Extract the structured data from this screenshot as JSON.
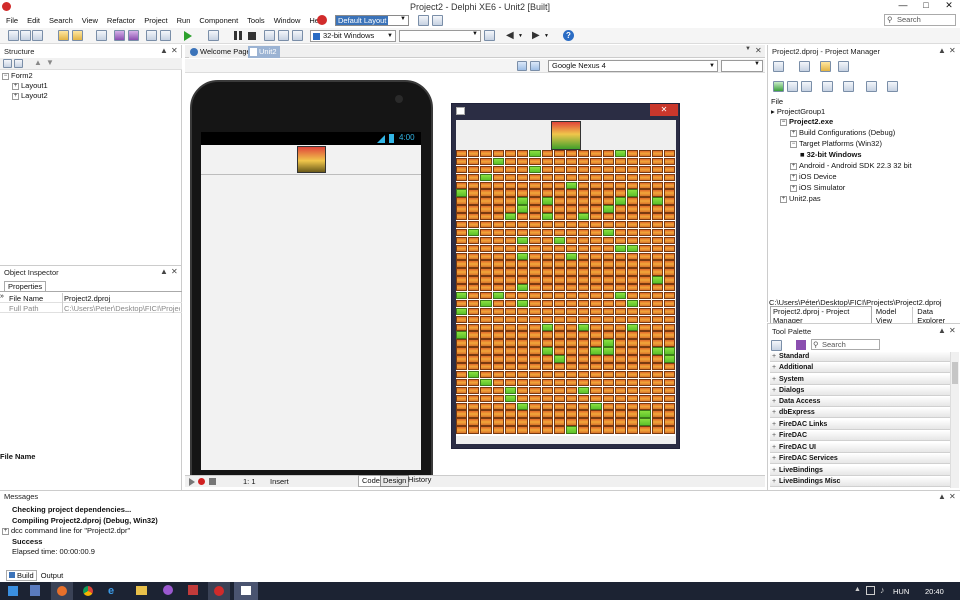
{
  "window": {
    "title": "Project2 - Delphi XE6 - Unit2 [Built]"
  },
  "menu": [
    "File",
    "Edit",
    "Search",
    "View",
    "Refactor",
    "Project",
    "Run",
    "Component",
    "Tools",
    "Window",
    "Help"
  ],
  "layout_select": "Default Layout",
  "search_placeholder": "Search",
  "platform_select": "32-bit Windows",
  "structure": {
    "title": "Structure",
    "items": [
      "Form2",
      "Layout1",
      "Layout2"
    ]
  },
  "tabs": {
    "welcome": "Welcome Page",
    "unit": "Unit2"
  },
  "device": {
    "select": "Google Nexus 4",
    "time": "4:00"
  },
  "object_inspector": {
    "title": "Object Inspector",
    "tab": "Properties",
    "rows": [
      {
        "name": "File Name",
        "value": "Project2.dproj"
      },
      {
        "name": "Full Path",
        "value": "C:\\Users\\Peter\\Desktop\\FICI\\Projects\\"
      }
    ],
    "footer": "File Name"
  },
  "project_manager": {
    "title": "Project2.dproj - Project Manager",
    "header": "File",
    "items": [
      "ProjectGroup1",
      "Project2.exe",
      "Build Configurations (Debug)",
      "Target Platforms (Win32)",
      "32-bit Windows",
      "Android - Android SDK 22.3 32 bit",
      "iOS Device",
      "iOS Simulator",
      "Unit2.pas"
    ],
    "path": "C:\\Users\\Péter\\Desktop\\FICI\\Projects\\Project2.dproj",
    "tabs": [
      "Project2.dproj - Project Manager",
      "Model View",
      "Data Explorer"
    ]
  },
  "tool_palette": {
    "title": "Tool Palette",
    "search": "Search",
    "categories": [
      "Standard",
      "Additional",
      "System",
      "Dialogs",
      "Data Access",
      "dbExpress",
      "FireDAC Links",
      "FireDAC",
      "FireDAC UI",
      "FireDAC Services",
      "LiveBindings",
      "LiveBindings Misc"
    ]
  },
  "editor_status": {
    "pos": "1:  1",
    "mode": "Insert",
    "tabs": [
      "Code",
      "Design",
      "History"
    ]
  },
  "messages": {
    "title": "Messages",
    "lines": [
      "Checking project dependencies...",
      "Compiling Project2.dproj (Debug, Win32)",
      "dcc command line for \"Project2.dpr\"",
      "Success",
      "Elapsed time: 00:00:00.9"
    ],
    "tabs": [
      "Build",
      "Output"
    ]
  },
  "taskbar": {
    "lang": "HUN",
    "time": "20:40"
  },
  "colors": {
    "accent": "#3b73b9",
    "title_bg": "#ffffff",
    "taskbar": "#1c2333"
  }
}
